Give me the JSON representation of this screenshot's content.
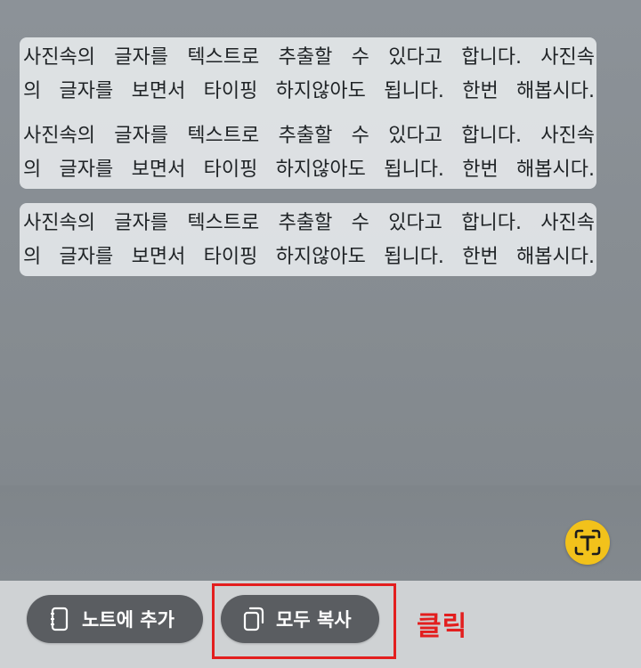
{
  "photo_text": {
    "blocks": [
      {
        "lines": [
          "사진속의 글자를 텍스트로 추출할 수 있다고 합니다. 사진속",
          "의 글자를 보면서 타이핑 하지않아도 됩니다. 한번 해봅시다.",
          "사진속의 글자를 텍스트로 추출할 수 있다고 합니다. 사진속",
          "의 글자를 보면서 타이핑 하지않아도 됩니다. 한번 해봅시다."
        ]
      },
      {
        "lines": [
          "사진속의 글자를 텍스트로 추출할 수 있다고 합니다. 사진속",
          "의 글자를 보면서 타이핑 하지않아도 됩니다. 한번 해봅시다."
        ]
      }
    ]
  },
  "text_scan_button": {
    "icon": "text-scan-icon",
    "color": "#f2c21b"
  },
  "actions": {
    "add_to_note_label": "노트에 추가",
    "add_to_note_icon": "notebook-icon",
    "copy_all_label": "모두 복사",
    "copy_all_icon": "copy-icon"
  },
  "annotation": {
    "label": "클릭",
    "color": "#e31e1e"
  }
}
